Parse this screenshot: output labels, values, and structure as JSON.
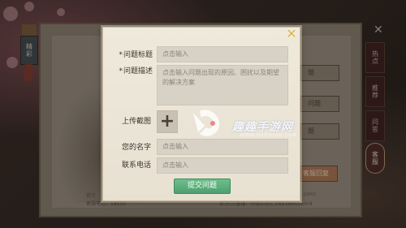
{
  "background": {
    "bookmark_label": "精彩",
    "side_tabs": [
      "热点",
      "推荐",
      "问答",
      "客服"
    ],
    "side_close": "✕",
    "peek_buttons": [
      "题",
      "问题",
      "题"
    ],
    "peek_reply_button": "客服回复",
    "footer_left_1": "官方",
    "footer_left_2": "客服电话：",
    "footer_left_phone": "18550",
    "footer_right_1": ".com/",
    "footer_right_2": "官方CC直播：https://cc.163.com/sword"
  },
  "form": {
    "close_symbol": "✕",
    "title_label": "问题标题",
    "title_placeholder": "点击输入",
    "desc_label": "问题描述",
    "desc_placeholder": "点击输入问题出现的原因、困扰以及期望的解决方案",
    "screenshot_label": "上传截图",
    "upload_symbol": "+",
    "name_label": "您的名字",
    "name_placeholder": "点击输入",
    "phone_label": "联系电话",
    "phone_placeholder": "点击输入",
    "submit_label": "提交问题",
    "required_mark": "*"
  },
  "watermark": {
    "text": "趣趣手游网",
    "url": "WWW.QUQUYOU.COM"
  },
  "colors": {
    "submit_button": "#4ea06f",
    "close_icon": "#d9b557",
    "modal_bg": "#efe9dc"
  }
}
